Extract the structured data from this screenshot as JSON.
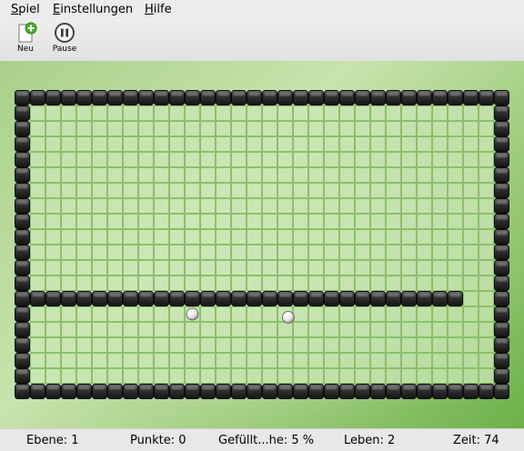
{
  "menu": {
    "items": [
      {
        "accel": "S",
        "rest": "piel"
      },
      {
        "accel": "E",
        "rest": "instellungen"
      },
      {
        "accel": "H",
        "rest": "ilfe"
      }
    ]
  },
  "toolbar": {
    "new_label": "Neu",
    "pause_label": "Pause"
  },
  "board": {
    "cols": 32,
    "rows": 20,
    "wall_rows": [
      13
    ],
    "wall_row_extent": 28,
    "balls": [
      {
        "col": 11.5,
        "row": 14.5
      },
      {
        "col": 17.7,
        "row": 14.7
      }
    ]
  },
  "status": {
    "level": "Ebene: 1",
    "points": "Punkte: 0",
    "filled": "Gefüllt...he: 5 %",
    "lives": "Leben: 2",
    "time": "Zeit: 74"
  },
  "colors": {
    "grid_fill": "#c9e6b4",
    "grid_line": "#8cbf6c",
    "block": "#2e2e2e",
    "accent_green": "#4caf2a"
  }
}
